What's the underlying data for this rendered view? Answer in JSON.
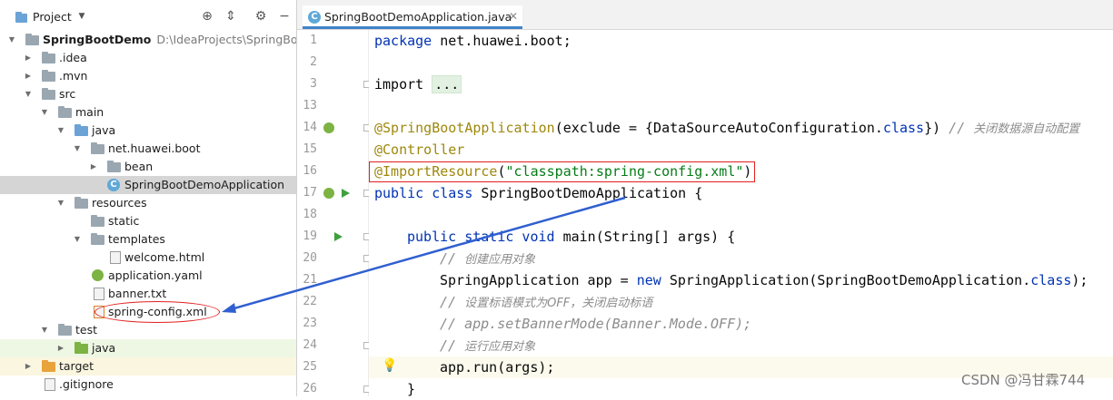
{
  "project_panel": {
    "title": "Project",
    "tree": [
      {
        "label": "SpringBootDemo",
        "path": "D:\\IdeaProjects\\SpringBootD"
      },
      {
        "label": ".idea"
      },
      {
        "label": ".mvn"
      },
      {
        "label": "src"
      },
      {
        "label": "main"
      },
      {
        "label": "java"
      },
      {
        "label": "net.huawei.boot"
      },
      {
        "label": "bean"
      },
      {
        "label": "SpringBootDemoApplication"
      },
      {
        "label": "resources"
      },
      {
        "label": "static"
      },
      {
        "label": "templates"
      },
      {
        "label": "welcome.html"
      },
      {
        "label": "application.yaml"
      },
      {
        "label": "banner.txt"
      },
      {
        "label": "spring-config.xml"
      },
      {
        "label": "test"
      },
      {
        "label": "java"
      },
      {
        "label": "target"
      },
      {
        "label": ".gitignore"
      }
    ]
  },
  "editor": {
    "tab_label": "SpringBootDemoApplication.java",
    "line_numbers": [
      "1",
      "2",
      "3",
      "13",
      "14",
      "15",
      "16",
      "17",
      "18",
      "19",
      "20",
      "21",
      "22",
      "23",
      "24",
      "25",
      "26"
    ],
    "code": {
      "l1_kw": "package",
      "l1_rest": " net.huawei.boot;",
      "l3_kw": "import",
      "l3_ph": "...",
      "l14_ann": "@SpringBootApplication",
      "l14_a": "(exclude = {DataSourceAutoConfiguration.",
      "l14_cls": "class",
      "l14_b": "}) ",
      "l14_cmt": "// ",
      "l14_cmt_cn": "关闭数据源自动配置",
      "l15_ann": "@Controller",
      "l16_ann": "@ImportResource",
      "l16_p1": "(",
      "l16_str": "\"classpath:spring-config.xml\"",
      "l16_p2": ")",
      "l17_kw": "public class",
      "l17_rest": " SpringBootDemoApplication {",
      "l19_kw": "public static void",
      "l19_rest": " main(String[] args) {",
      "l20_cmt": "// ",
      "l20_cn": "创建应用对象",
      "l21_a": "SpringApplication app = ",
      "l21_kw": "new",
      "l21_b": " SpringApplication(SpringBootDemoApplication.",
      "l21_cls": "class",
      "l21_c": ");",
      "l22_cmt": "// ",
      "l22_cn": "设置标语模式为OFF，关闭启动标语",
      "l23_cmt": "// app.setBannerMode(Banner.Mode.OFF);",
      "l24_cmt": "// ",
      "l24_cn": "运行应用对象",
      "l25": "app.run(args);",
      "l26": "}"
    }
  },
  "watermark": "CSDN @冯甘霖744",
  "colors": {
    "annotation_red": "#e02020",
    "arrow_blue": "#2f5fd0",
    "selection": "#d5d5d5"
  }
}
